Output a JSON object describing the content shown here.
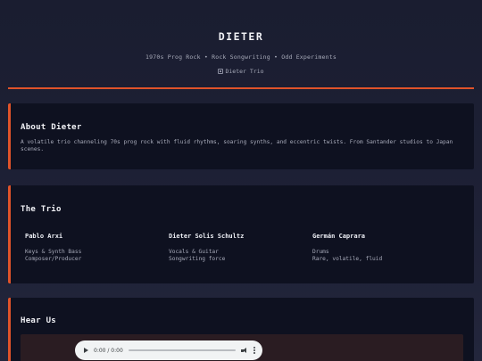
{
  "header": {
    "title": "DIETER",
    "tagline": "1970s Prog Rock • Rock Songwriting • Odd Experiments",
    "hero_image_alt": "Dieter Trio"
  },
  "about": {
    "heading": "About Dieter",
    "text": "A volatile trio channeling 70s prog rock with fluid rhythms, soaring synths, and eccentric twists. From Santander studios to Japan scenes."
  },
  "trio": {
    "heading": "The Trio",
    "members": [
      {
        "name": "Pablo Arxi",
        "role_line1": "Keys & Synth Bass",
        "role_line2": "Composer/Producer"
      },
      {
        "name": "Dieter Solis Schultz",
        "role_line1": "Vocals & Guitar",
        "role_line2": "Songwriting force"
      },
      {
        "name": "Germán Caprara",
        "role_line1": "Drums",
        "role_line2": "Rare, volatile, fluid"
      }
    ]
  },
  "hear": {
    "heading": "Hear Us",
    "player": {
      "time": "0:00 / 0:00",
      "progress": 0
    }
  },
  "colors": {
    "accent": "#e0532a",
    "background": "#1c1f33",
    "card": "#0e1120"
  },
  "icons": {
    "hero": "broken-image-icon",
    "play": "play-icon",
    "volume": "volume-icon",
    "more": "more-options-icon"
  }
}
